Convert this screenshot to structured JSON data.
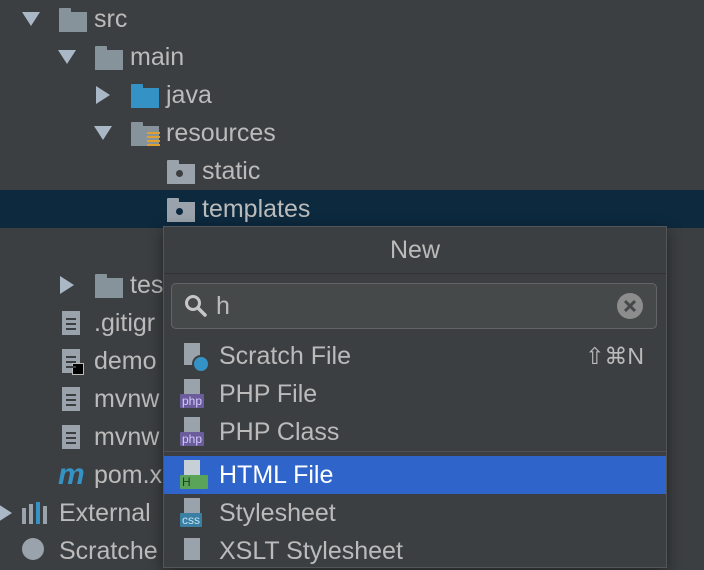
{
  "tree": {
    "src": "src",
    "main": "main",
    "java": "java",
    "resources": "resources",
    "static": "static",
    "templates": "templates",
    "test": "tes",
    "gitignore": ".gitigr",
    "demo": "demo",
    "mvnw1": "mvnw",
    "mvnw2": "mvnw",
    "pom": "pom.x",
    "external": "External",
    "scratches": "Scratche"
  },
  "popup": {
    "title": "New",
    "search_value": "h",
    "items": [
      {
        "label": "Scratch File",
        "shortcut": "⇧⌘N",
        "icon": "scratch-file-icon"
      },
      {
        "label": "PHP File",
        "icon": "php-file-icon",
        "badge": "php"
      },
      {
        "label": "PHP Class",
        "icon": "php-class-icon",
        "badge": "php"
      },
      {
        "label": "HTML File",
        "icon": "html-file-icon",
        "badge": "H",
        "selected": true
      },
      {
        "label": "Stylesheet",
        "icon": "css-file-icon",
        "badge": "css"
      },
      {
        "label": "XSLT Stylesheet",
        "icon": "xslt-file-icon"
      }
    ]
  },
  "colors": {
    "background": "#3c3f41",
    "selection_row": "#0d293e",
    "active_item": "#2f65ca",
    "folder": "#87939a",
    "java_folder": "#3592c4"
  }
}
